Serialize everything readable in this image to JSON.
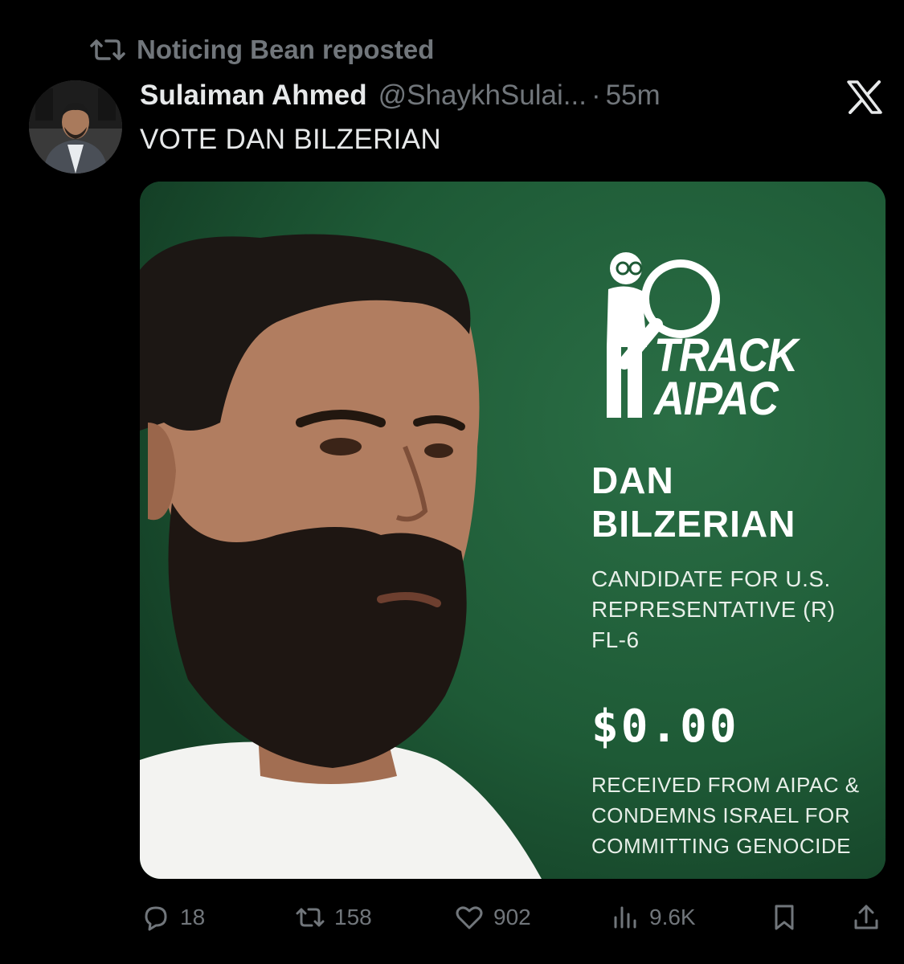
{
  "repost": {
    "text": "Noticing Bean reposted",
    "icon": "repost-icon"
  },
  "tweet": {
    "display_name": "Sulaiman Ahmed",
    "handle": "@ShaykhSulai...",
    "separator": "·",
    "time": "55m",
    "text": "VOTE DAN BILZERIAN"
  },
  "media": {
    "logo_line1": "TRACK",
    "logo_line2": "AIPAC",
    "name_line1": "DAN",
    "name_line2": "BILZERIAN",
    "desc_line1": "CANDIDATE FOR U.S.",
    "desc_line2": "REPRESENTATIVE (R)",
    "desc_line3": "FL-6",
    "amount": "$0.00",
    "received_line1": "RECEIVED FROM AIPAC &",
    "received_line2": "CONDEMNS ISRAEL FOR",
    "received_line3": "COMMITTING GENOCIDE",
    "background_color": "#1f5a36"
  },
  "actions": {
    "replies": "18",
    "reposts": "158",
    "likes": "902",
    "views": "9.6K"
  },
  "colors": {
    "muted": "#71767b",
    "text": "#e7e9ea",
    "background": "#000000"
  }
}
